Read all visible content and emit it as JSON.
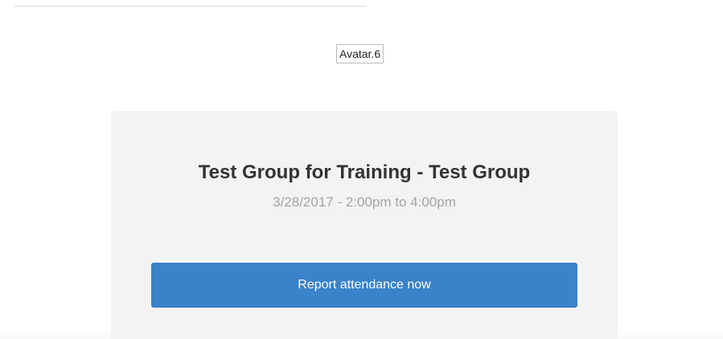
{
  "avatar": {
    "label": "Avatar.6"
  },
  "event": {
    "title": "Test Group for Training - Test Group",
    "datetime": "3/28/2017 - 2:00pm to 4:00pm"
  },
  "actions": {
    "report_attendance_label": "Report attendance now"
  }
}
